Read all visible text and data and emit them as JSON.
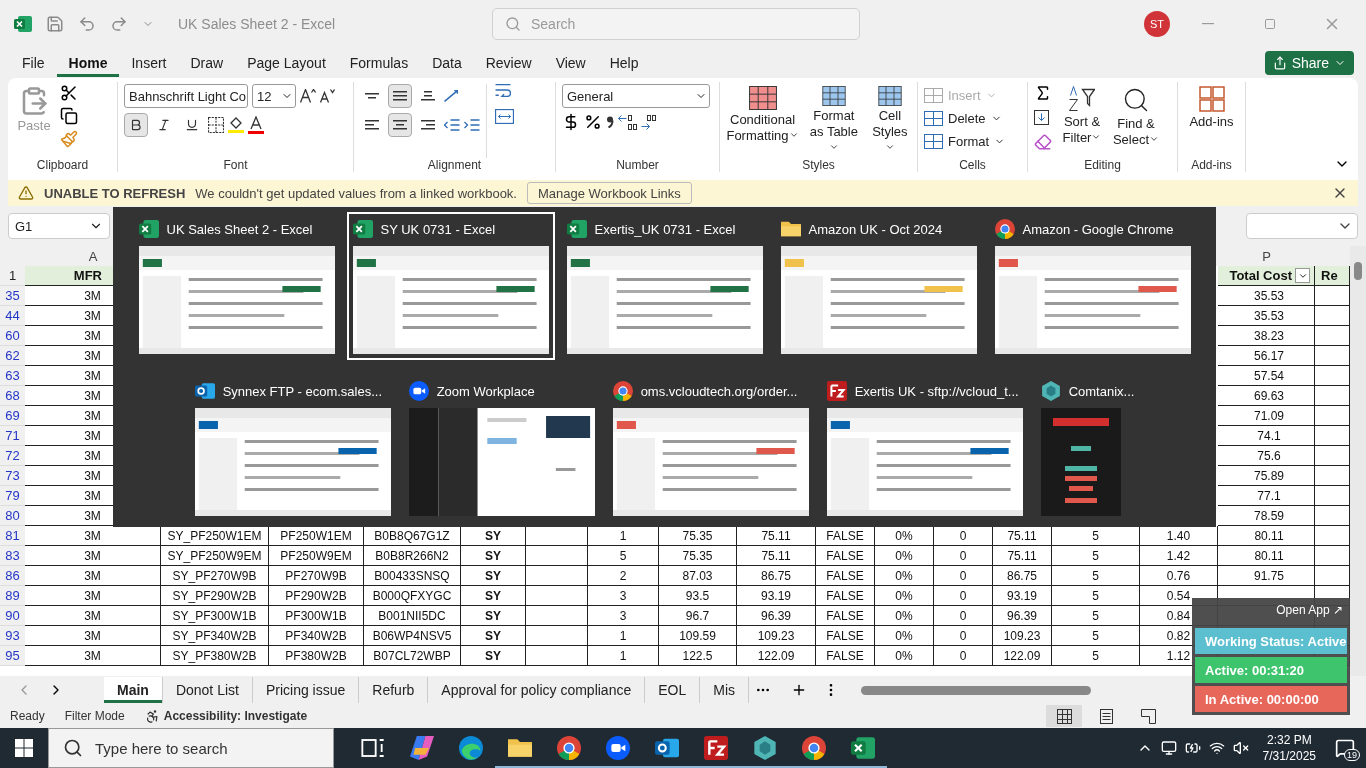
{
  "title_bar": {
    "title": "UK Sales Sheet 2  -  Excel",
    "search_placeholder": "Search",
    "avatar": "ST"
  },
  "menu": {
    "tabs": [
      {
        "label": "File",
        "selected": false
      },
      {
        "label": "Home",
        "selected": true
      },
      {
        "label": "Insert",
        "selected": false
      },
      {
        "label": "Draw",
        "selected": false
      },
      {
        "label": "Page Layout",
        "selected": false
      },
      {
        "label": "Formulas",
        "selected": false
      },
      {
        "label": "Data",
        "selected": false
      },
      {
        "label": "Review",
        "selected": false
      },
      {
        "label": "View",
        "selected": false
      },
      {
        "label": "Help",
        "selected": false
      }
    ],
    "share": "Share"
  },
  "ribbon": {
    "clipboard": {
      "paste": "Paste",
      "label": "Clipboard"
    },
    "font": {
      "name": "Bahnschrift Light Co",
      "size": "12",
      "bold": true,
      "italic": false,
      "underline": false,
      "label": "Font"
    },
    "alignment": {
      "middle": true,
      "center": true,
      "label": "Alignment"
    },
    "number": {
      "format": "General",
      "label": "Number"
    },
    "styles": {
      "buttons": [
        "Conditional Formatting",
        "Format as Table",
        "Cell Styles"
      ],
      "label": "Styles"
    },
    "cells": {
      "buttons": [
        {
          "label": "Insert",
          "disabled": true
        },
        {
          "label": "Delete",
          "disabled": false
        },
        {
          "label": "Format",
          "disabled": false
        }
      ],
      "label": "Cells"
    },
    "editing": {
      "buttons": [
        "Sort & Filter",
        "Find & Select"
      ],
      "label": "Editing"
    },
    "addins": {
      "button": "Add-ins",
      "label": "Add-ins"
    }
  },
  "message_bar": {
    "title": "UNABLE TO REFRESH",
    "text": "We couldn't get updated values from a linked workbook.",
    "button": "Manage Workbook Links"
  },
  "formula_bar": {
    "name_box": "G1"
  },
  "sheet": {
    "column_headers": [
      {
        "letter": "A",
        "title": "MFR",
        "filter": false
      },
      {
        "letter": "P",
        "title": "Total Cost",
        "filter": true
      }
    ],
    "cut_header": "Re",
    "header_row": "1",
    "rows": [
      {
        "n": "35",
        "mfr": "3M",
        "total": "35.53"
      },
      {
        "n": "44",
        "mfr": "3M",
        "total": "35.53"
      },
      {
        "n": "60",
        "mfr": "3M",
        "total": "38.23"
      },
      {
        "n": "62",
        "mfr": "3M",
        "total": "56.17"
      },
      {
        "n": "63",
        "mfr": "3M",
        "total": "57.54"
      },
      {
        "n": "68",
        "mfr": "3M",
        "total": "69.63"
      },
      {
        "n": "69",
        "mfr": "3M",
        "total": "71.09"
      },
      {
        "n": "71",
        "mfr": "3M",
        "total": "74.1"
      },
      {
        "n": "72",
        "mfr": "3M",
        "total": "75.6"
      },
      {
        "n": "73",
        "mfr": "3M",
        "total": "75.89"
      },
      {
        "n": "79",
        "mfr": "3M",
        "total": "77.1"
      },
      {
        "n": "80",
        "mfr": "3M",
        "total": "78.59"
      },
      {
        "n": "81",
        "mfr": "3M",
        "cells": [
          "SY_PF250W1EM",
          "PF250W1EM",
          "B0B8Q67G1Z",
          "SY",
          "1",
          "75.35",
          "75.11",
          "FALSE",
          "0%",
          "0",
          "75.11",
          "5",
          "1.40"
        ],
        "total": "80.11"
      },
      {
        "n": "83",
        "mfr": "3M",
        "cells": [
          "SY_PF250W9EM",
          "PF250W9EM",
          "B0B8R266N2",
          "SY",
          "5",
          "75.35",
          "75.11",
          "FALSE",
          "0%",
          "0",
          "75.11",
          "5",
          "1.42"
        ],
        "total": "80.11"
      },
      {
        "n": "86",
        "mfr": "3M",
        "cells": [
          "SY_PF270W9B",
          "PF270W9B",
          "B00433SNSQ",
          "SY",
          "2",
          "87.03",
          "86.75",
          "FALSE",
          "0%",
          "0",
          "86.75",
          "5",
          "0.76"
        ],
        "total": "91.75"
      },
      {
        "n": "89",
        "mfr": "3M",
        "cells": [
          "SY_PF290W2B",
          "PF290W2B",
          "B000QFXYGC",
          "SY",
          "3",
          "93.5",
          "93.19",
          "FALSE",
          "0%",
          "0",
          "93.19",
          "5",
          "0.54"
        ]
      },
      {
        "n": "90",
        "mfr": "3M",
        "cells": [
          "SY_PF300W1B",
          "PF300W1B",
          "B001NII5DC",
          "SY",
          "3",
          "96.7",
          "96.39",
          "FALSE",
          "0%",
          "0",
          "96.39",
          "5",
          "0.84"
        ]
      },
      {
        "n": "93",
        "mfr": "3M",
        "cells": [
          "SY_PF340W2B",
          "PF340W2B",
          "B06WP4NSV5",
          "SY",
          "1",
          "109.59",
          "109.23",
          "FALSE",
          "0%",
          "0",
          "109.23",
          "5",
          "0.82"
        ]
      },
      {
        "n": "95",
        "mfr": "3M",
        "cells": [
          "SY_PF380W2B",
          "PF380W2B",
          "B07CL72WBP",
          "SY",
          "1",
          "122.5",
          "122.09",
          "FALSE",
          "0%",
          "0",
          "122.09",
          "5",
          "1.12"
        ]
      }
    ]
  },
  "sheet_tabs": [
    {
      "label": "Main",
      "selected": true
    },
    {
      "label": "Donot List",
      "selected": false
    },
    {
      "label": "Pricing issue",
      "selected": false
    },
    {
      "label": "Refurb",
      "selected": false
    },
    {
      "label": "Approval for policy compliance",
      "selected": false
    },
    {
      "label": "EOL",
      "selected": false
    },
    {
      "label": "Mis",
      "selected": false
    }
  ],
  "status_bar": {
    "items": [
      "Ready",
      "Filter Mode"
    ],
    "accessibility": "Accessibility: Investigate",
    "views": [
      {
        "kind": "normal",
        "selected": true
      },
      {
        "kind": "page_layout",
        "selected": false
      },
      {
        "kind": "page_break",
        "selected": false
      }
    ]
  },
  "task_switcher": {
    "rows": [
      {
        "windows": [
          {
            "title": "UK Sales Sheet 2 - Excel",
            "kind": "excel",
            "selected": false
          },
          {
            "title": "SY UK 0731 - Excel",
            "kind": "excel",
            "selected": true
          },
          {
            "title": "Exertis_UK 0731 - Excel",
            "kind": "excel",
            "selected": false
          },
          {
            "title": "Amazon UK - Oct 2024",
            "kind": "folder",
            "selected": false
          },
          {
            "title": "Amazon - Google Chrome",
            "kind": "chrome",
            "selected": false
          }
        ]
      },
      {
        "windows": [
          {
            "title": "Synnex FTP - ecom.sales...",
            "kind": "outlook",
            "selected": false
          },
          {
            "title": "Zoom Workplace",
            "kind": "zoom",
            "selected": false
          },
          {
            "title": "oms.vcloudtech.org/order...",
            "kind": "chrome",
            "selected": false
          },
          {
            "title": "Exertis UK - sftp://vcloud_t...",
            "kind": "filezilla",
            "selected": false
          },
          {
            "title": "Comtanix...",
            "kind": "comtanix",
            "selected": false
          }
        ]
      }
    ]
  },
  "tracker_widget": {
    "open_app": "Open App ↗",
    "bars": [
      {
        "text": "Working Status: Active",
        "color": "#5bbfcf"
      },
      {
        "text": "Active: 00:31:20",
        "color": "#3ec46d"
      },
      {
        "text": "In Active: 00:00:00",
        "color": "#e8675b"
      }
    ]
  },
  "taskbar": {
    "search_placeholder": "Type here to search",
    "apps": [
      {
        "kind": "task_view",
        "running": false
      },
      {
        "kind": "copilot",
        "running": false
      },
      {
        "kind": "edge",
        "running": false
      },
      {
        "kind": "explorer",
        "running": true
      },
      {
        "kind": "chrome",
        "running": true
      },
      {
        "kind": "zoom",
        "running": true
      },
      {
        "kind": "outlook",
        "running": true
      },
      {
        "kind": "filezilla",
        "running": true
      },
      {
        "kind": "comtanix",
        "running": true
      },
      {
        "kind": "chrome",
        "running": true
      },
      {
        "kind": "excel",
        "running": true
      }
    ],
    "time": "2:32 PM",
    "date": "7/31/2025",
    "notifications": "19"
  }
}
